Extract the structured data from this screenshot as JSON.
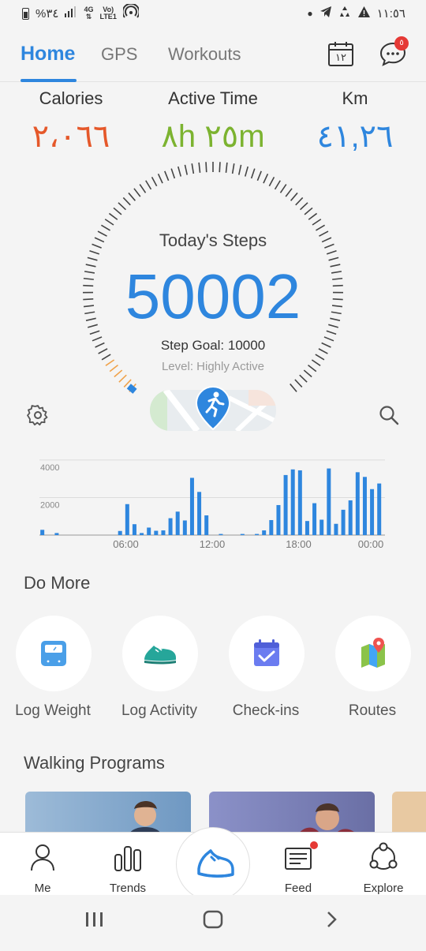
{
  "status_bar": {
    "battery": "%٣٤",
    "network_top": "4G",
    "network_bottom": "LTE1",
    "volte": "Vo)",
    "time": "١١:٥٦"
  },
  "tabs": [
    {
      "label": "Home",
      "active": true
    },
    {
      "label": "GPS",
      "active": false
    },
    {
      "label": "Workouts",
      "active": false
    }
  ],
  "calendar_day": "١٢",
  "chat_badge": "٥",
  "stats": [
    {
      "label": "Calories",
      "value": "٢،٠٦٦",
      "color": "#e5582a"
    },
    {
      "label": "Active Time",
      "value": "٨h ٢٥m",
      "color": "#7cb330"
    },
    {
      "label": "Km",
      "value": "٤١,٢٦",
      "color": "#2e86de"
    }
  ],
  "steps": {
    "title": "Today's Steps",
    "value": "50002",
    "goal": "Step Goal: 10000",
    "level": "Level: Highly Active"
  },
  "chart_data": {
    "type": "bar",
    "ylim": [
      0,
      4500
    ],
    "yticks": [
      "4000",
      "2000"
    ],
    "xticks": [
      "06:00",
      "12:00",
      "18:00",
      "00:00"
    ],
    "values": [
      280,
      0,
      0,
      110,
      0,
      0,
      0,
      0,
      0,
      0,
      0,
      0,
      0,
      0,
      0,
      0,
      0,
      0,
      0,
      0,
      0,
      0,
      0,
      0,
      0,
      0,
      0,
      0,
      0,
      0,
      0,
      0,
      0,
      0,
      0,
      0,
      0,
      0,
      0,
      0,
      0,
      0,
      0,
      0,
      220,
      0,
      1650,
      0,
      580,
      0,
      110,
      0,
      400,
      0,
      230,
      0,
      250,
      0,
      900,
      0,
      1250,
      0,
      780,
      0,
      3050,
      0,
      2300,
      0,
      1050,
      0,
      0,
      0,
      60,
      0,
      0,
      0,
      0,
      0,
      60,
      0,
      60,
      0,
      0,
      0,
      0,
      0,
      0,
      0,
      0,
      0,
      0,
      0,
      0,
      0,
      0,
      0,
      0,
      0,
      0,
      0,
      0,
      0,
      0,
      0,
      0,
      0,
      0,
      0,
      0,
      0,
      0,
      0,
      0,
      0,
      0,
      0,
      0,
      0,
      0,
      0,
      0,
      0,
      0,
      0,
      0,
      0,
      0,
      0,
      0,
      0,
      0,
      0,
      0,
      0,
      0,
      0,
      0,
      0,
      0,
      0,
      0,
      0
    ]
  },
  "bars": [
    {
      "t": 0.2,
      "v": 280
    },
    {
      "t": 1.2,
      "v": 110
    },
    {
      "t": 5.6,
      "v": 220
    },
    {
      "t": 6.1,
      "v": 1650
    },
    {
      "t": 6.6,
      "v": 580
    },
    {
      "t": 7.1,
      "v": 110
    },
    {
      "t": 7.6,
      "v": 400
    },
    {
      "t": 8.1,
      "v": 230
    },
    {
      "t": 8.6,
      "v": 250
    },
    {
      "t": 9.1,
      "v": 900
    },
    {
      "t": 9.6,
      "v": 1250
    },
    {
      "t": 10.1,
      "v": 780
    },
    {
      "t": 10.6,
      "v": 3050
    },
    {
      "t": 11.1,
      "v": 2300
    },
    {
      "t": 11.6,
      "v": 1050
    },
    {
      "t": 12.6,
      "v": 60
    },
    {
      "t": 14.1,
      "v": 60
    },
    {
      "t": 15.1,
      "v": 60
    },
    {
      "t": 15.6,
      "v": 250
    },
    {
      "t": 16.1,
      "v": 800
    },
    {
      "t": 16.6,
      "v": 1600
    },
    {
      "t": 17.1,
      "v": 3200
    },
    {
      "t": 17.6,
      "v": 3500
    },
    {
      "t": 18.1,
      "v": 3450
    },
    {
      "t": 18.6,
      "v": 750
    },
    {
      "t": 19.1,
      "v": 1700
    },
    {
      "t": 19.6,
      "v": 820
    },
    {
      "t": 20.1,
      "v": 3550
    },
    {
      "t": 20.6,
      "v": 600
    },
    {
      "t": 21.1,
      "v": 1350
    },
    {
      "t": 21.6,
      "v": 1850
    },
    {
      "t": 22.1,
      "v": 3350
    },
    {
      "t": 22.6,
      "v": 3100
    },
    {
      "t": 23.1,
      "v": 2450
    },
    {
      "t": 23.6,
      "v": 2750
    }
  ],
  "do_more": {
    "title": "Do More",
    "items": [
      {
        "label": "Log Weight",
        "icon": "scale-icon"
      },
      {
        "label": "Log Activity",
        "icon": "shoe-icon"
      },
      {
        "label": "Check-ins",
        "icon": "calendar-check-icon"
      },
      {
        "label": "Routes",
        "icon": "map-pin-icon"
      }
    ]
  },
  "walking_programs": {
    "title": "Walking Programs"
  },
  "bottom_nav": [
    {
      "label": "Me",
      "icon": "person-icon"
    },
    {
      "label": "Trends",
      "icon": "bar-chart-icon"
    },
    {
      "label": "",
      "icon": "shoe-icon"
    },
    {
      "label": "Feed",
      "icon": "newspaper-icon"
    },
    {
      "label": "Explore",
      "icon": "network-icon"
    }
  ],
  "colors": {
    "accent": "#2e86de",
    "calories": "#e5582a",
    "active_time": "#7cb330",
    "gauge_tick": "#444444",
    "gauge_end": "#f0a24a",
    "badge": "#e53935"
  }
}
